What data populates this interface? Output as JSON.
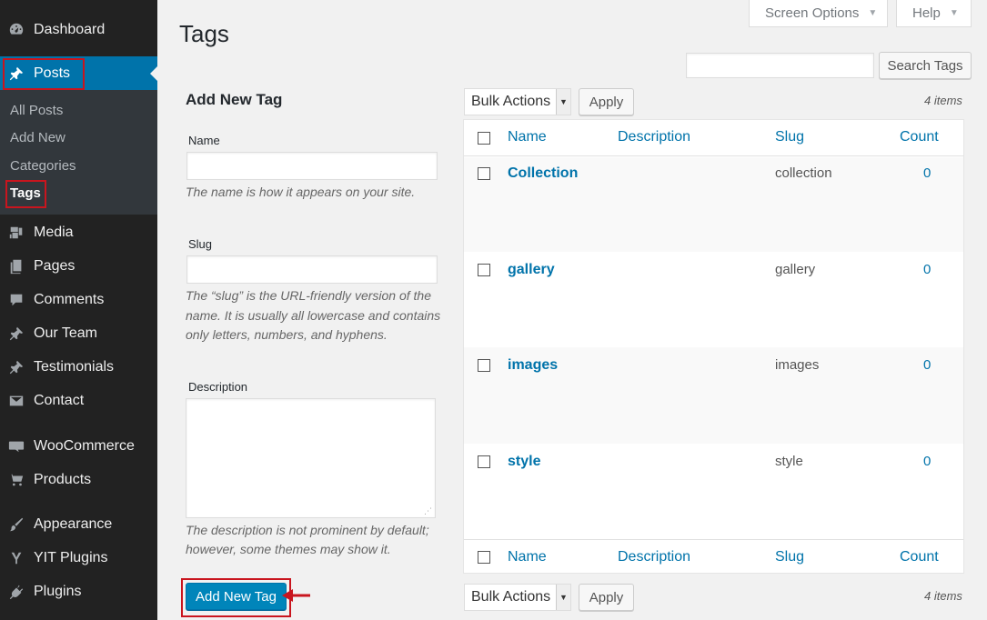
{
  "sidebar": {
    "items": [
      {
        "label": "Dashboard",
        "icon": "dashboard-icon"
      },
      {
        "label": "Posts",
        "icon": "pin-icon"
      },
      {
        "label": "Media",
        "icon": "media-icon"
      },
      {
        "label": "Pages",
        "icon": "pages-icon"
      },
      {
        "label": "Comments",
        "icon": "comments-icon"
      },
      {
        "label": "Our Team",
        "icon": "pin-icon"
      },
      {
        "label": "Testimonials",
        "icon": "pin-icon"
      },
      {
        "label": "Contact",
        "icon": "mail-icon"
      },
      {
        "label": "WooCommerce",
        "icon": "woocommerce-icon"
      },
      {
        "label": "Products",
        "icon": "cart-icon"
      },
      {
        "label": "Appearance",
        "icon": "brush-icon"
      },
      {
        "label": "YIT Plugins",
        "icon": "yit-icon"
      },
      {
        "label": "Plugins",
        "icon": "plug-icon"
      }
    ],
    "submenu": [
      "All Posts",
      "Add New",
      "Categories",
      "Tags"
    ]
  },
  "header": {
    "title": "Tags",
    "screen_options": "Screen Options",
    "help": "Help"
  },
  "search": {
    "button": "Search Tags",
    "value": ""
  },
  "form": {
    "title": "Add New Tag",
    "name_label": "Name",
    "name_help": "The name is how it appears on your site.",
    "slug_label": "Slug",
    "slug_help_1": "The “slug” is the URL-friendly version of the",
    "slug_help_2": "name. It is usually all lowercase and contains",
    "slug_help_3": "only letters, numbers, and hyphens.",
    "description_label": "Description",
    "description_help_1": "The description is not prominent by default;",
    "description_help_2": "however, some themes may show it.",
    "submit": "Add New Tag"
  },
  "table": {
    "bulk_actions": "Bulk Actions",
    "apply": "Apply",
    "items_count": "4 items",
    "columns": {
      "name": "Name",
      "description": "Description",
      "slug": "Slug",
      "count": "Count"
    },
    "rows": [
      {
        "name": "Collection",
        "description": "",
        "slug": "collection",
        "count": "0"
      },
      {
        "name": "gallery",
        "description": "",
        "slug": "gallery",
        "count": "0"
      },
      {
        "name": "images",
        "description": "",
        "slug": "images",
        "count": "0"
      },
      {
        "name": "style",
        "description": "",
        "slug": "style",
        "count": "0"
      }
    ]
  },
  "colors": {
    "sidebar_bg": "#222222",
    "active_menu": "#0073aa",
    "link": "#0073aa",
    "highlight": "#c9151e",
    "primary_button": "#0085ba"
  }
}
